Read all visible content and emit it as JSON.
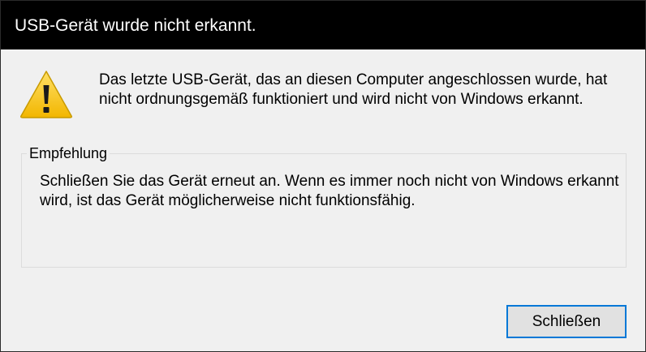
{
  "dialog": {
    "title": "USB-Gerät wurde nicht erkannt.",
    "icon": "warning-icon",
    "message": "Das letzte USB-Gerät, das an diesen Computer angeschlossen wurde, hat nicht ordnungsgemäß funktioniert und wird nicht von Windows erkannt.",
    "recommendation": {
      "heading": "Empfehlung",
      "text": "Schließen Sie das Gerät erneut an. Wenn es immer noch nicht von Windows erkannt wird, ist das Gerät möglicherweise nicht funktionsfähig."
    },
    "close_button_label": "Schließen"
  },
  "colors": {
    "titlebar": "#000000",
    "background": "#f0f0f0",
    "button_focus_border": "#0078d7",
    "warning_yellow": "#f4c400"
  }
}
